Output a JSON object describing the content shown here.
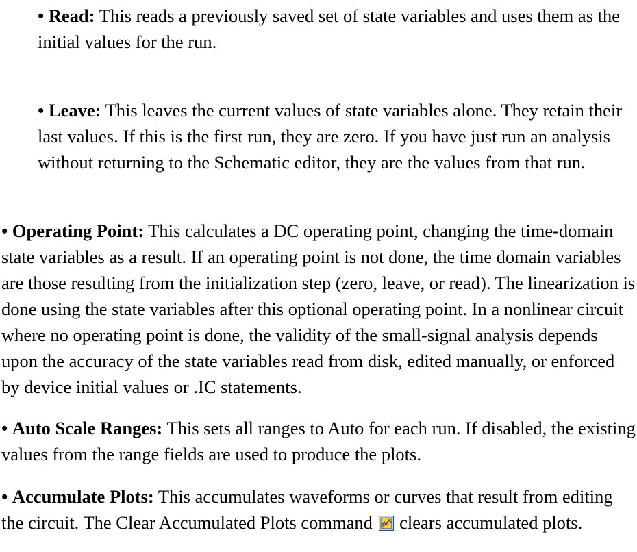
{
  "bullet": "•",
  "paragraphs": {
    "read": {
      "term": "Read:",
      "text": " This reads a previously saved set of state variables and uses them as the initial values for the run."
    },
    "leave": {
      "term": "Leave:",
      "text": " This leaves the current values of state variables alone. They retain their last values. If this is the first run, they are zero. If you have just run an analysis without returning to the Schematic editor, they are the values from that run."
    },
    "operating_point": {
      "term": "Operating Point:",
      "text": " This calculates a DC operating point, changing the time-domain state variables as a result. If an operating point is not done, the time domain variables are those resulting from the initialization step (zero, leave, or read). The linearization is done using the state variables after this optional operating point. In a nonlinear circuit where no operating point is done, the validity of the small-signal analysis depends upon the accuracy of the state variables read from disk, edited manually, or enforced by device initial values or .IC statements."
    },
    "auto_scale": {
      "term": "Auto Scale Ranges:",
      "text": " This sets all ranges to Auto for each run. If disabled, the existing values from the range fields are used to produce the plots."
    },
    "accumulate": {
      "term": "Accumulate Plots:",
      "text_before": " This accumulates waveforms or curves that result from editing the circuit. The Clear Accumulated Plots command ",
      "icon": "clear-accumulated-plots-icon",
      "text_after": " clears accumulated plots."
    }
  },
  "colors": {
    "text": "#000000",
    "icon_border": "#1a4fa8",
    "icon_fill": "#f4d23c"
  }
}
